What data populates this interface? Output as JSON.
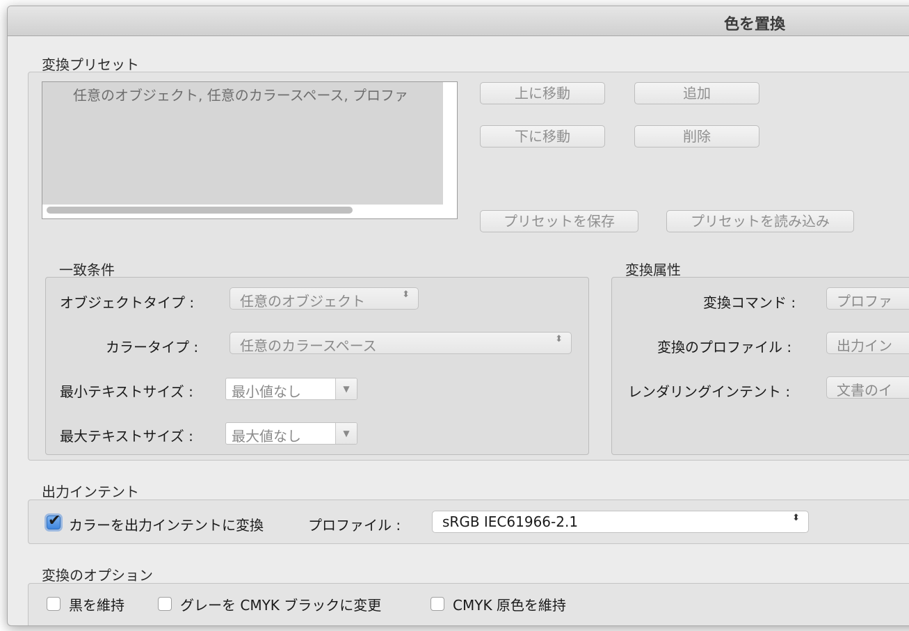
{
  "window": {
    "title": "色を置換"
  },
  "preset": {
    "section_label": "変換プリセット",
    "list_item": "任意のオブジェクト, 任意のカラースペース, プロファ",
    "buttons": {
      "move_up": "上に移動",
      "add": "追加",
      "move_down": "下に移動",
      "delete": "削除",
      "save_preset": "プリセットを保存",
      "load_preset": "プリセットを読み込み"
    }
  },
  "match": {
    "section_label": "一致条件",
    "object_type_label": "オブジェクトタイプ :",
    "object_type_value": "任意のオブジェクト",
    "color_type_label": "カラータイプ :",
    "color_type_value": "任意のカラースペース",
    "min_text_label": "最小テキストサイズ :",
    "min_text_value": "最小値なし",
    "max_text_label": "最大テキストサイズ :",
    "max_text_value": "最大値なし"
  },
  "convert": {
    "section_label": "変換属性",
    "command_label": "変換コマンド :",
    "command_value": "プロファ",
    "profile_label": "変換のプロファイル :",
    "profile_value": "出力イン",
    "intent_label": "レンダリングインテント :",
    "intent_value": "文書のイ"
  },
  "output_intent": {
    "section_label": "出力インテント",
    "convert_checkbox_label": "カラーを出力インテントに変換",
    "convert_checked": true,
    "profile_label": "プロファイル :",
    "profile_value": "sRGB IEC61966-2.1"
  },
  "options": {
    "section_label": "変換のオプション",
    "keep_black": "黒を維持",
    "gray_to_black": "グレーを CMYK ブラックに変更",
    "keep_cmyk": "CMYK 原色を維持"
  },
  "icons": {
    "updown_arrows": "⬍",
    "down_triangle": "▼",
    "checkmark": "✔"
  }
}
